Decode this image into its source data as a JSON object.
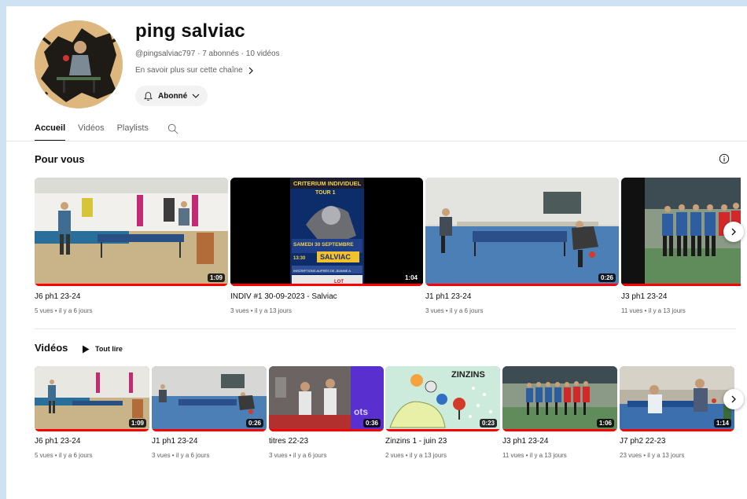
{
  "channel": {
    "name": "ping salviac",
    "meta": "@pingsalviac797 · 7 abonnés · 10 vidéos",
    "more_link": "En savoir plus sur cette chaîne",
    "subscribe_label": "Abonné",
    "avatar_icon": "channel-avatar"
  },
  "tabs": [
    {
      "label": "Accueil",
      "active": true
    },
    {
      "label": "Vidéos",
      "active": false
    },
    {
      "label": "Playlists",
      "active": false
    }
  ],
  "for_you": {
    "title": "Pour vous",
    "videos": [
      {
        "title": "J6 ph1 23-24",
        "meta": "5 vues • il y a 6 jours",
        "duration": "1:09",
        "watched": 1.0
      },
      {
        "title": "INDIV #1 30-09-2023 - Salviac",
        "meta": "3 vues • il y a 13 jours",
        "duration": "1:04",
        "watched": 1.0
      },
      {
        "title": "J1 ph1 23-24",
        "meta": "3 vues • il y a 6 jours",
        "duration": "0:26",
        "watched": 1.0
      },
      {
        "title": "J3 ph1 23-24",
        "meta": "11 vues • il y a 13 jours",
        "duration": "",
        "watched": 1.0
      }
    ],
    "poster_text": {
      "line1": "CRITERIUM INDIVIDUEL",
      "line2": "TOUR 1",
      "line3": "SAMEDI 30 SEPTEMBRE",
      "line4": "SALVIAC",
      "line5": "13:30",
      "line6": "INSCRIPTIONS AUPRÈS DE JEANNE A",
      "line7": "LOT"
    }
  },
  "videos_section": {
    "title": "Vidéos",
    "play_all": "Tout lire",
    "videos": [
      {
        "title": "J6 ph1 23-24",
        "meta": "5 vues • il y a 6 jours",
        "duration": "1:09",
        "watched": 1.0
      },
      {
        "title": "J1 ph1 23-24",
        "meta": "3 vues • il y a 6 jours",
        "duration": "0:26",
        "watched": 1.0
      },
      {
        "title": "titres 22-23",
        "meta": "3 vues • il y a 6 jours",
        "duration": "0:36",
        "watched": 1.0
      },
      {
        "title": "Zinzins 1 - juin 23",
        "meta": "2 vues • il y a 13 jours",
        "duration": "0:23",
        "watched": 1.0
      },
      {
        "title": "J3 ph1 23-24",
        "meta": "11 vues • il y a 13 jours",
        "duration": "1:06",
        "watched": 1.0
      },
      {
        "title": "J7 ph2 22-23",
        "meta": "23 vues • il y a 13 jours",
        "duration": "1:14",
        "watched": 1.0
      }
    ],
    "zinzins_text": "ZINZINS",
    "ots_text": "ots"
  },
  "colors": {
    "progress": "#ff0000",
    "accent_text": "#0f0f0f",
    "meta_text": "#606060"
  }
}
